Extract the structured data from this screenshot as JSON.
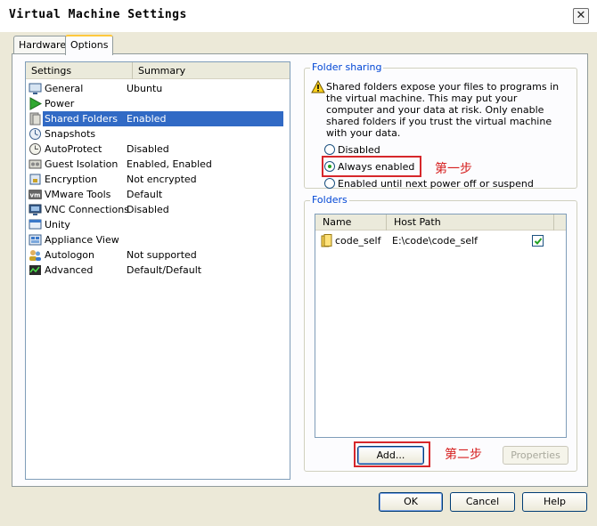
{
  "window": {
    "title": "Virtual Machine Settings",
    "close_glyph": "✕"
  },
  "tabs": [
    {
      "label": "Hardware",
      "active": false
    },
    {
      "label": "Options",
      "active": true
    }
  ],
  "settings_list": {
    "headers": {
      "settings": "Settings",
      "summary": "Summary"
    },
    "items": [
      {
        "name": "General",
        "summary": "Ubuntu",
        "icon": "monitor-icon"
      },
      {
        "name": "Power",
        "summary": "",
        "icon": "play-icon"
      },
      {
        "name": "Shared Folders",
        "summary": "Enabled",
        "icon": "shared-folder-icon",
        "selected": true
      },
      {
        "name": "Snapshots",
        "summary": "",
        "icon": "snapshot-icon"
      },
      {
        "name": "AutoProtect",
        "summary": "Disabled",
        "icon": "clock-icon"
      },
      {
        "name": "Guest Isolation",
        "summary": "Enabled, Enabled",
        "icon": "isolation-icon"
      },
      {
        "name": "Encryption",
        "summary": "Not encrypted",
        "icon": "lock-icon"
      },
      {
        "name": "VMware Tools",
        "summary": "Default",
        "icon": "vm-icon"
      },
      {
        "name": "VNC Connections",
        "summary": "Disabled",
        "icon": "vnc-icon"
      },
      {
        "name": "Unity",
        "summary": "",
        "icon": "unity-icon"
      },
      {
        "name": "Appliance View",
        "summary": "",
        "icon": "appliance-icon"
      },
      {
        "name": "Autologon",
        "summary": "Not supported",
        "icon": "users-icon"
      },
      {
        "name": "Advanced",
        "summary": "Default/Default",
        "icon": "advanced-icon"
      }
    ]
  },
  "folder_sharing": {
    "title": "Folder sharing",
    "warning": "Shared folders expose your files to programs in the virtual machine. This may put your computer and your data at risk. Only enable shared folders if you trust the virtual machine with your data.",
    "options": [
      {
        "label": "Disabled",
        "checked": false
      },
      {
        "label": "Always enabled",
        "checked": true
      },
      {
        "label": "Enabled until next power off or suspend",
        "checked": false
      }
    ],
    "annotation": "第一步"
  },
  "folders": {
    "title": "Folders",
    "headers": {
      "name": "Name",
      "host_path": "Host Path"
    },
    "rows": [
      {
        "name": "code_self",
        "host_path": "E:\\code\\code_self",
        "enabled": true
      }
    ],
    "buttons": {
      "add": "Add...",
      "properties": "Properties"
    },
    "annotation": "第二步"
  },
  "footer": {
    "ok": "OK",
    "cancel": "Cancel",
    "help": "Help"
  },
  "colors": {
    "selection": "#316ac5",
    "group_title": "#0046d5",
    "annotation": "#d62020"
  }
}
